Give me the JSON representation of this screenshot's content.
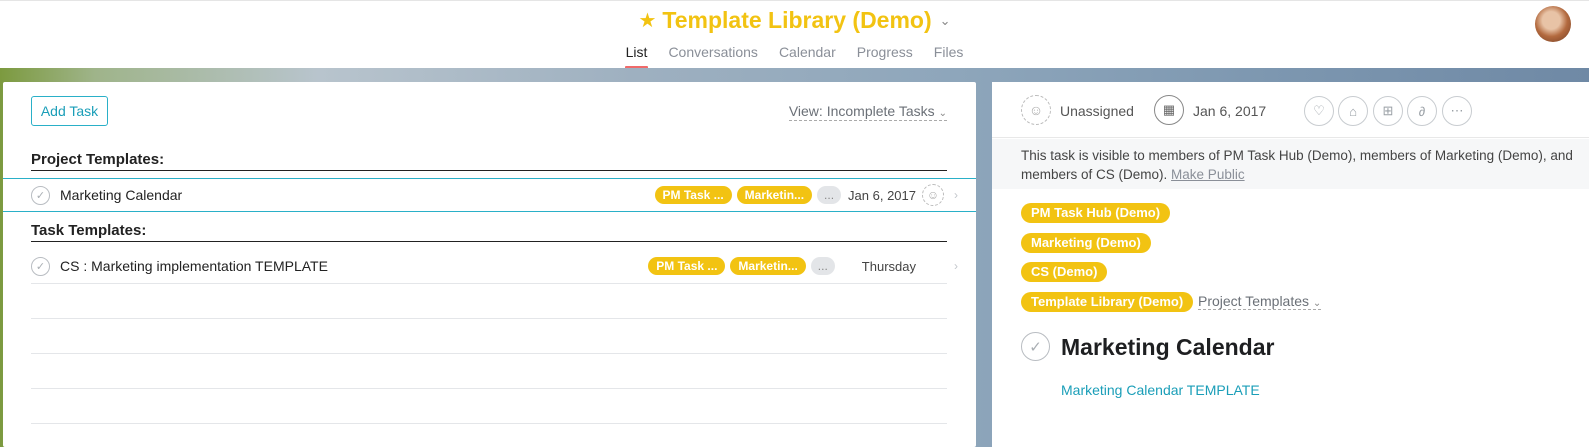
{
  "header": {
    "title": "Template Library (Demo)",
    "tabs": [
      {
        "label": "List",
        "active": true
      },
      {
        "label": "Conversations"
      },
      {
        "label": "Calendar"
      },
      {
        "label": "Progress"
      },
      {
        "label": "Files"
      }
    ]
  },
  "list": {
    "add_task_label": "Add Task",
    "view_label": "View: Incomplete Tasks",
    "sections": [
      {
        "name": "Project Templates:",
        "tasks": [
          {
            "name": "Marketing Calendar",
            "tags": [
              "PM Task ...",
              "Marketin..."
            ],
            "more": "...",
            "date": "Jan 6, 2017",
            "selected": true
          }
        ]
      },
      {
        "name": "Task Templates:",
        "tasks": [
          {
            "name": "CS : Marketing implementation TEMPLATE",
            "tags": [
              "PM Task ...",
              "Marketin..."
            ],
            "more": "...",
            "date": "Thursday"
          }
        ]
      }
    ]
  },
  "detail": {
    "assignee": "Unassigned",
    "due_date": "Jan 6, 2017",
    "visibility_line1": "This task is visible to members of PM Task Hub (Demo), members of Marketing (Demo), and",
    "visibility_line2": "members of CS (Demo).",
    "make_public": "Make Public",
    "projects": [
      "PM Task Hub (Demo)",
      "Marketing (Demo)",
      "CS (Demo)",
      "Template Library (Demo)"
    ],
    "section": "Project Templates",
    "task_title": "Marketing Calendar",
    "description_link": "Marketing Calendar TEMPLATE"
  },
  "colors": {
    "accent_yellow": "#f2c312",
    "teal": "#2ab0c8",
    "tab_underline": "#f06a6a"
  }
}
